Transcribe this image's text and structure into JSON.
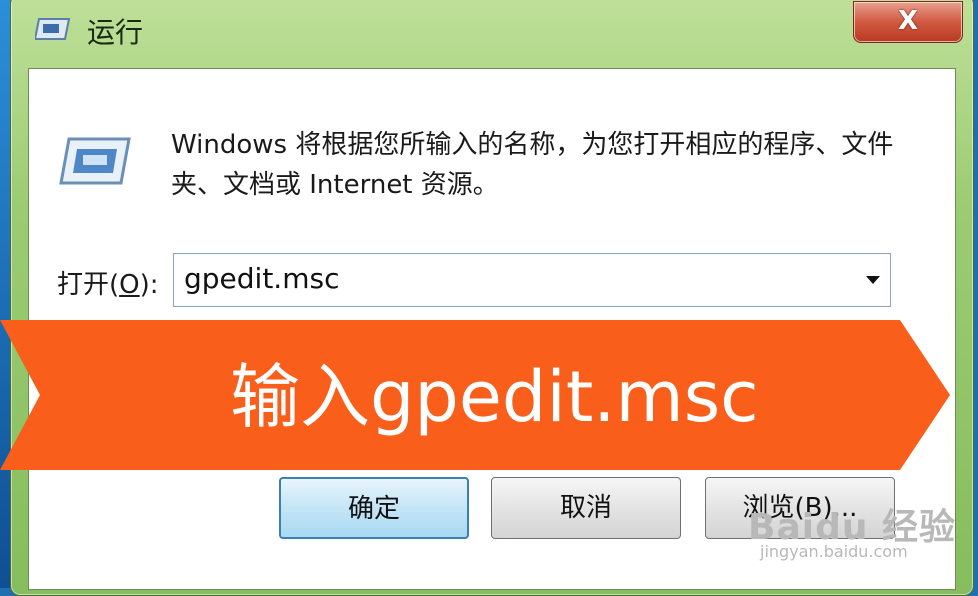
{
  "window": {
    "title": "运行",
    "close_glyph": "X",
    "frame_color": "#9ccc72",
    "icon": "run-app-icon"
  },
  "dialog": {
    "description": "Windows 将根据您所输入的名称，为您打开相应的程序、文件夹、文档或 Internet 资源。",
    "open_label_prefix": "打开(",
    "open_label_key": "O",
    "open_label_suffix": "):",
    "input_value": "gpedit.msc"
  },
  "buttons": {
    "ok": "确定",
    "cancel": "取消",
    "browse": "浏览(B)..."
  },
  "banner": {
    "text": "输入gpedit.msc",
    "color": "#f95e1a"
  },
  "watermark": {
    "logo": "Baidu 经验",
    "url": "jingyan.baidu.com"
  }
}
